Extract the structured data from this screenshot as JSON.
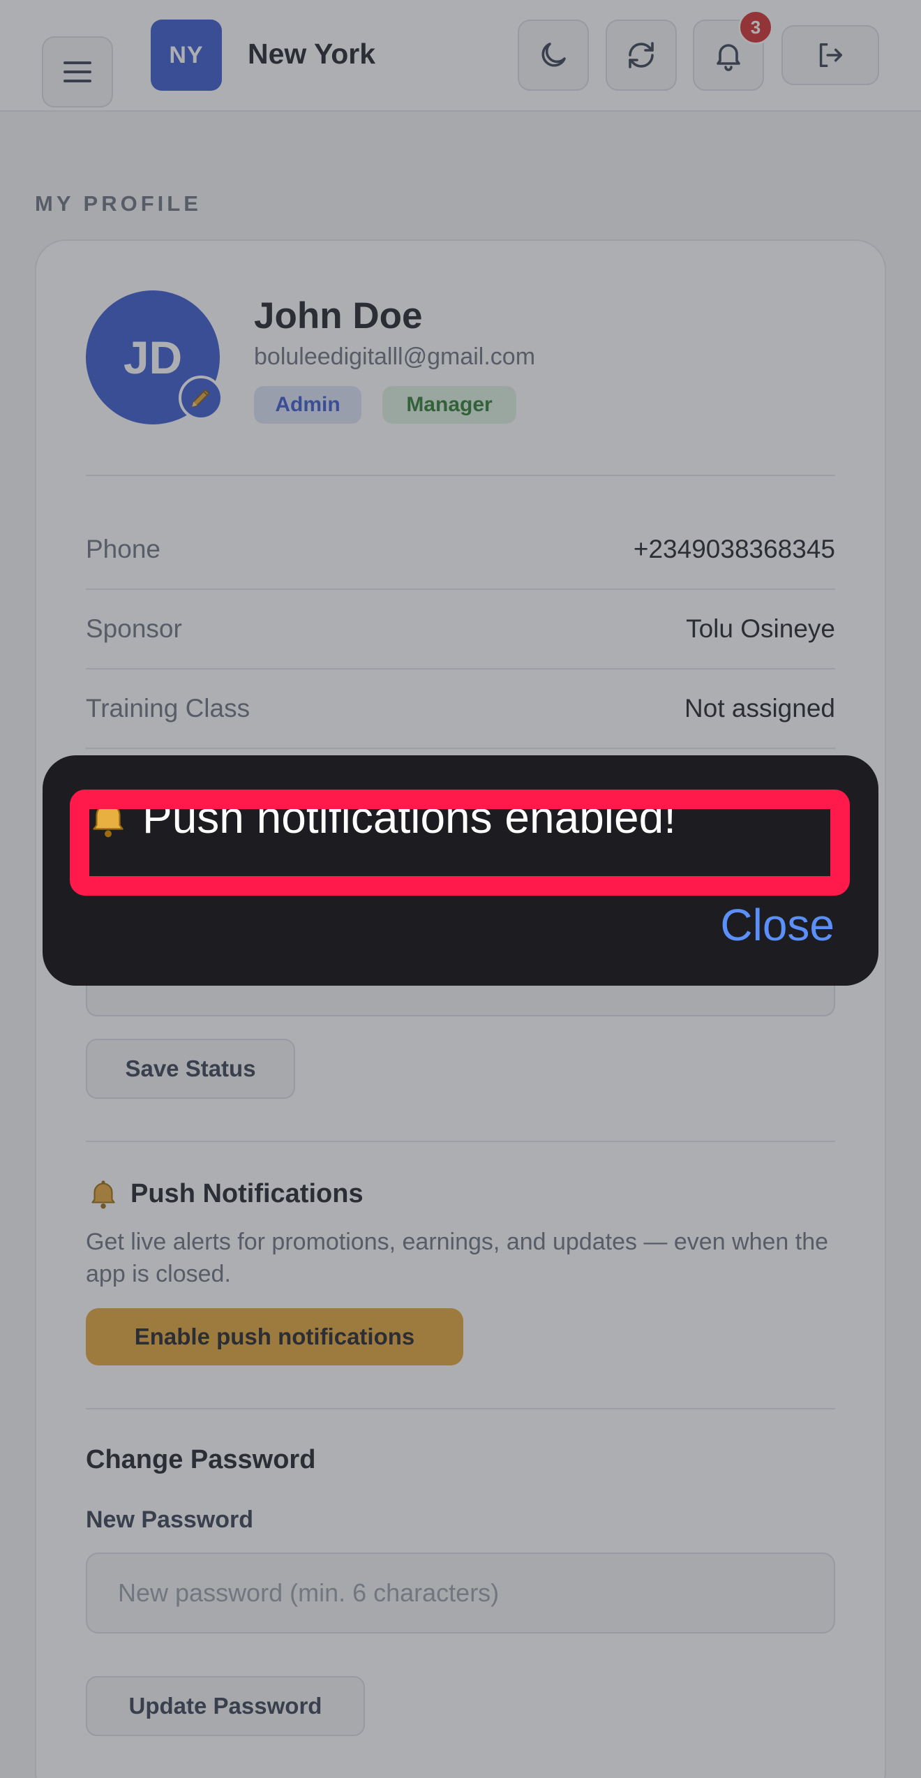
{
  "header": {
    "logo_initials": "NY",
    "city": "New York",
    "notification_count": "3"
  },
  "profile": {
    "section_title": "MY PROFILE",
    "avatar_initials": "JD",
    "name": "John Doe",
    "email": "boluleedigitalll@gmail.com",
    "roles": [
      "Admin",
      "Manager"
    ],
    "rows": [
      {
        "label": "Phone",
        "value": "+2349038368345"
      },
      {
        "label": "Sponsor",
        "value": "Tolu Osineye"
      },
      {
        "label": "Training Class",
        "value": "Not assigned"
      }
    ]
  },
  "status": {
    "save_label": "Save Status"
  },
  "push": {
    "title": "Push Notifications",
    "description": "Get live alerts for promotions, earnings, and updates — even when the app is closed.",
    "enable_label": "Enable push notifications"
  },
  "password": {
    "title": "Change Password",
    "new_label": "New Password",
    "placeholder": "New password (min. 6 characters)",
    "update_label": "Update Password"
  },
  "toast": {
    "message": "Push notifications enabled!",
    "close_label": "Close"
  },
  "colors": {
    "brand": "#3a5bd0",
    "accent_button": "#e3a63a",
    "highlight": "#ff1a4b",
    "badge": "#d32f2f"
  }
}
